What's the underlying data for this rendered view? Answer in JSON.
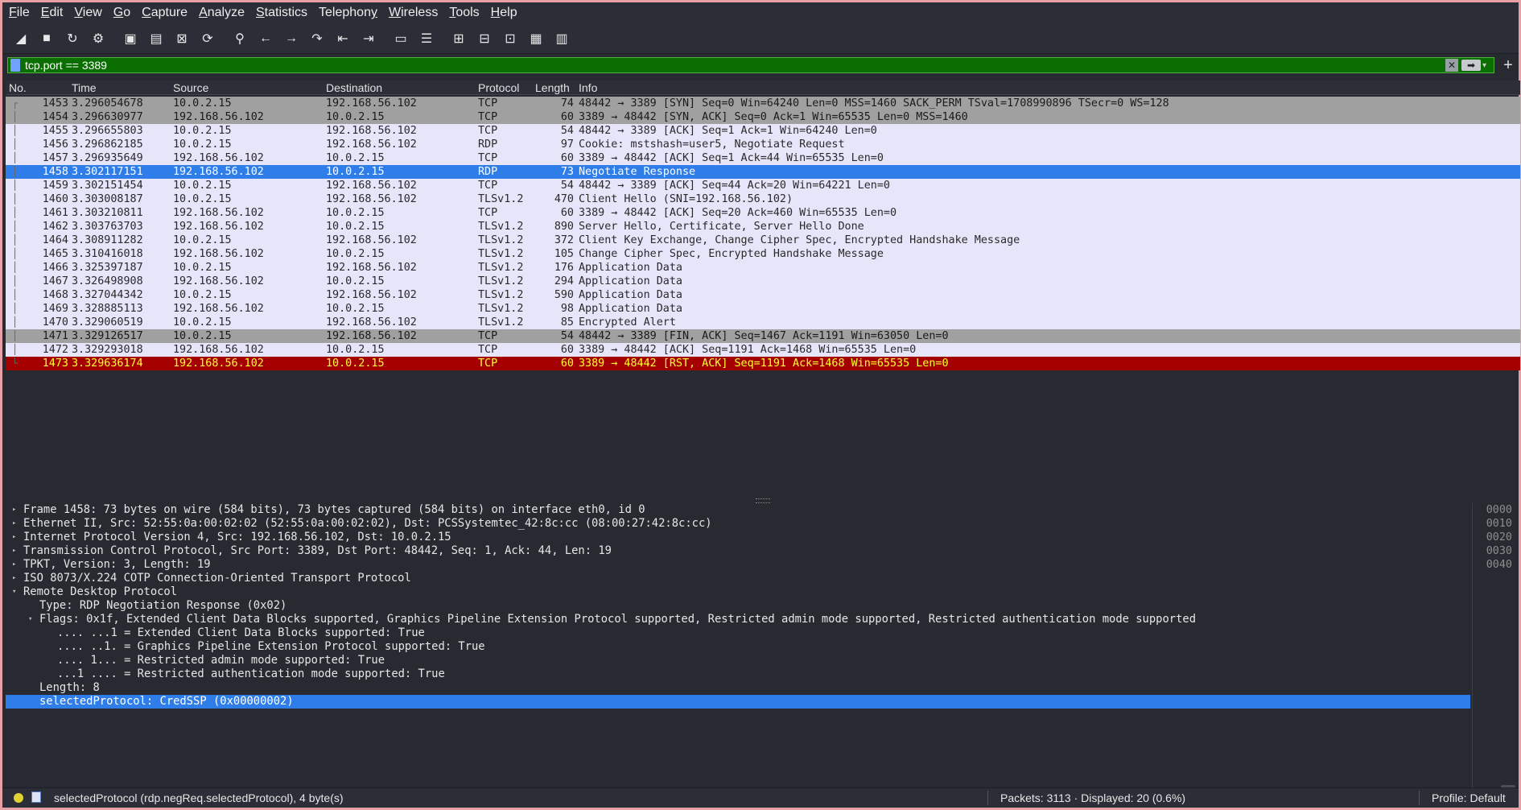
{
  "menu": [
    "File",
    "Edit",
    "View",
    "Go",
    "Capture",
    "Analyze",
    "Statistics",
    "Telephony",
    "Wireless",
    "Tools",
    "Help"
  ],
  "menu_mnemonics": [
    "F",
    "E",
    "V",
    "G",
    "C",
    "A",
    "S",
    "y",
    "W",
    "T",
    "H"
  ],
  "toolbar": [
    {
      "name": "shark-fin-start-icon",
      "glyph": "◢"
    },
    {
      "name": "stop-square-icon",
      "glyph": "■"
    },
    {
      "name": "restart-fin-icon",
      "glyph": "↻"
    },
    {
      "name": "capture-options-gear-icon",
      "glyph": "⚙"
    },
    {
      "name": "open-file-icon",
      "glyph": "▣"
    },
    {
      "name": "save-file-icon",
      "glyph": "▤"
    },
    {
      "name": "close-file-icon",
      "glyph": "⊠"
    },
    {
      "name": "reload-file-icon",
      "glyph": "⟳"
    },
    {
      "name": "find-packet-icon",
      "glyph": "⚲"
    },
    {
      "name": "go-back-icon",
      "glyph": "←"
    },
    {
      "name": "go-forward-icon",
      "glyph": "→"
    },
    {
      "name": "go-to-packet-icon",
      "glyph": "↷"
    },
    {
      "name": "go-first-icon",
      "glyph": "⇤"
    },
    {
      "name": "go-last-icon",
      "glyph": "⇥"
    },
    {
      "name": "autoscroll-icon",
      "glyph": "▭"
    },
    {
      "name": "colorize-icon",
      "glyph": "☰"
    },
    {
      "name": "zoom-in-icon",
      "glyph": "⊞"
    },
    {
      "name": "zoom-out-icon",
      "glyph": "⊟"
    },
    {
      "name": "normal-size-icon",
      "glyph": "⊡"
    },
    {
      "name": "resize-columns-icon",
      "glyph": "▦"
    },
    {
      "name": "layout-icon",
      "glyph": "▥"
    }
  ],
  "filter": {
    "value": "tcp.port == 3389",
    "clear": "✕",
    "apply": "➡",
    "dropdown": "▾",
    "add": "+"
  },
  "columns": {
    "no": "No.",
    "time": "Time",
    "source": "Source",
    "destination": "Destination",
    "protocol": "Protocol",
    "length": "Length",
    "info": "Info"
  },
  "packets": [
    {
      "no": "1453",
      "time": "3.296054678",
      "src": "10.0.2.15",
      "dst": "192.168.56.102",
      "proto": "TCP",
      "len": "74",
      "info": "48442 → 3389 [SYN] Seq=0 Win=64240 Len=0 MSS=1460 SACK_PERM TSval=1708990896 TSecr=0 WS=128",
      "style": "syn",
      "rel": "┌"
    },
    {
      "no": "1454",
      "time": "3.296630977",
      "src": "192.168.56.102",
      "dst": "10.0.2.15",
      "proto": "TCP",
      "len": "60",
      "info": "3389 → 48442 [SYN, ACK] Seq=0 Ack=1 Win=65535 Len=0 MSS=1460",
      "style": "syn",
      "rel": "│"
    },
    {
      "no": "1455",
      "time": "3.296655803",
      "src": "10.0.2.15",
      "dst": "192.168.56.102",
      "proto": "TCP",
      "len": "54",
      "info": "48442 → 3389 [ACK] Seq=1 Ack=1 Win=64240 Len=0",
      "style": "tcp",
      "rel": "│"
    },
    {
      "no": "1456",
      "time": "3.296862185",
      "src": "10.0.2.15",
      "dst": "192.168.56.102",
      "proto": "RDP",
      "len": "97",
      "info": "Cookie: mstshash=user5, Negotiate Request",
      "style": "tcp",
      "rel": "│"
    },
    {
      "no": "1457",
      "time": "3.296935649",
      "src": "192.168.56.102",
      "dst": "10.0.2.15",
      "proto": "TCP",
      "len": "60",
      "info": "3389 → 48442 [ACK] Seq=1 Ack=44 Win=65535 Len=0",
      "style": "tcp",
      "rel": "│"
    },
    {
      "no": "1458",
      "time": "3.302117151",
      "src": "192.168.56.102",
      "dst": "10.0.2.15",
      "proto": "RDP",
      "len": "73",
      "info": "Negotiate Response",
      "style": "sel",
      "rel": "│"
    },
    {
      "no": "1459",
      "time": "3.302151454",
      "src": "10.0.2.15",
      "dst": "192.168.56.102",
      "proto": "TCP",
      "len": "54",
      "info": "48442 → 3389 [ACK] Seq=44 Ack=20 Win=64221 Len=0",
      "style": "tcp",
      "rel": "│"
    },
    {
      "no": "1460",
      "time": "3.303008187",
      "src": "10.0.2.15",
      "dst": "192.168.56.102",
      "proto": "TLSv1.2",
      "len": "470",
      "info": "Client Hello (SNI=192.168.56.102)",
      "style": "tcp",
      "rel": "│"
    },
    {
      "no": "1461",
      "time": "3.303210811",
      "src": "192.168.56.102",
      "dst": "10.0.2.15",
      "proto": "TCP",
      "len": "60",
      "info": "3389 → 48442 [ACK] Seq=20 Ack=460 Win=65535 Len=0",
      "style": "tcp",
      "rel": "│"
    },
    {
      "no": "1462",
      "time": "3.303763703",
      "src": "192.168.56.102",
      "dst": "10.0.2.15",
      "proto": "TLSv1.2",
      "len": "890",
      "info": "Server Hello, Certificate, Server Hello Done",
      "style": "tcp",
      "rel": "│"
    },
    {
      "no": "1464",
      "time": "3.308911282",
      "src": "10.0.2.15",
      "dst": "192.168.56.102",
      "proto": "TLSv1.2",
      "len": "372",
      "info": "Client Key Exchange, Change Cipher Spec, Encrypted Handshake Message",
      "style": "tcp",
      "rel": "│"
    },
    {
      "no": "1465",
      "time": "3.310416018",
      "src": "192.168.56.102",
      "dst": "10.0.2.15",
      "proto": "TLSv1.2",
      "len": "105",
      "info": "Change Cipher Spec, Encrypted Handshake Message",
      "style": "tcp",
      "rel": "│"
    },
    {
      "no": "1466",
      "time": "3.325397187",
      "src": "10.0.2.15",
      "dst": "192.168.56.102",
      "proto": "TLSv1.2",
      "len": "176",
      "info": "Application Data",
      "style": "tcp",
      "rel": "│"
    },
    {
      "no": "1467",
      "time": "3.326498908",
      "src": "192.168.56.102",
      "dst": "10.0.2.15",
      "proto": "TLSv1.2",
      "len": "294",
      "info": "Application Data",
      "style": "tcp",
      "rel": "│"
    },
    {
      "no": "1468",
      "time": "3.327044342",
      "src": "10.0.2.15",
      "dst": "192.168.56.102",
      "proto": "TLSv1.2",
      "len": "590",
      "info": "Application Data",
      "style": "tcp",
      "rel": "│"
    },
    {
      "no": "1469",
      "time": "3.328885113",
      "src": "192.168.56.102",
      "dst": "10.0.2.15",
      "proto": "TLSv1.2",
      "len": "98",
      "info": "Application Data",
      "style": "tcp",
      "rel": "│"
    },
    {
      "no": "1470",
      "time": "3.329060519",
      "src": "10.0.2.15",
      "dst": "192.168.56.102",
      "proto": "TLSv1.2",
      "len": "85",
      "info": "Encrypted Alert",
      "style": "tcp",
      "rel": "│"
    },
    {
      "no": "1471",
      "time": "3.329126517",
      "src": "10.0.2.15",
      "dst": "192.168.56.102",
      "proto": "TCP",
      "len": "54",
      "info": "48442 → 3389 [FIN, ACK] Seq=1467 Ack=1191 Win=63050 Len=0",
      "style": "syn",
      "rel": "│"
    },
    {
      "no": "1472",
      "time": "3.329293018",
      "src": "192.168.56.102",
      "dst": "10.0.2.15",
      "proto": "TCP",
      "len": "60",
      "info": "3389 → 48442 [ACK] Seq=1191 Ack=1468 Win=65535 Len=0",
      "style": "tcp",
      "rel": "│"
    },
    {
      "no": "1473",
      "time": "3.329636174",
      "src": "192.168.56.102",
      "dst": "10.0.2.15",
      "proto": "TCP",
      "len": "60",
      "info": "3389 → 48442 [RST, ACK] Seq=1191 Ack=1468 Win=65535 Len=0",
      "style": "rst",
      "rel": "└"
    }
  ],
  "details": [
    {
      "text": "Frame 1458: 73 bytes on wire (584 bits), 73 bytes captured (584 bits) on interface eth0, id 0",
      "indent": 0,
      "arrow": "▸"
    },
    {
      "text": "Ethernet II, Src: 52:55:0a:00:02:02 (52:55:0a:00:02:02), Dst: PCSSystemtec_42:8c:cc (08:00:27:42:8c:cc)",
      "indent": 0,
      "arrow": "▸"
    },
    {
      "text": "Internet Protocol Version 4, Src: 192.168.56.102, Dst: 10.0.2.15",
      "indent": 0,
      "arrow": "▸"
    },
    {
      "text": "Transmission Control Protocol, Src Port: 3389, Dst Port: 48442, Seq: 1, Ack: 44, Len: 19",
      "indent": 0,
      "arrow": "▸"
    },
    {
      "text": "TPKT, Version: 3, Length: 19",
      "indent": 0,
      "arrow": "▸"
    },
    {
      "text": "ISO 8073/X.224 COTP Connection-Oriented Transport Protocol",
      "indent": 0,
      "arrow": "▸"
    },
    {
      "text": "Remote Desktop Protocol",
      "indent": 0,
      "arrow": "▾"
    },
    {
      "text": "Type: RDP Negotiation Response (0x02)",
      "indent": 1,
      "arrow": ""
    },
    {
      "text": "Flags: 0x1f, Extended Client Data Blocks supported, Graphics Pipeline Extension Protocol supported, Restricted admin mode supported, Restricted authentication mode supported",
      "indent": 1,
      "arrow": "▾"
    },
    {
      "text": ".... ...1 = Extended Client Data Blocks supported: True",
      "indent": 2,
      "arrow": ""
    },
    {
      "text": ".... ..1. = Graphics Pipeline Extension Protocol supported: True",
      "indent": 2,
      "arrow": ""
    },
    {
      "text": ".... 1... = Restricted admin mode supported: True",
      "indent": 2,
      "arrow": ""
    },
    {
      "text": "...1 .... = Restricted authentication mode supported: True",
      "indent": 2,
      "arrow": ""
    },
    {
      "text": "Length: 8",
      "indent": 1,
      "arrow": ""
    },
    {
      "text": "selectedProtocol: CredSSP (0x00000002)",
      "indent": 1,
      "arrow": "",
      "selected": true
    }
  ],
  "bytes_offsets": [
    "0000",
    "0010",
    "0020",
    "0030",
    "0040"
  ],
  "status": {
    "field": "selectedProtocol (rdp.negReq.selectedProtocol), 4 byte(s)",
    "packets": "Packets: 3113 · Displayed: 20 (0.6%)",
    "profile": "Profile: Default"
  }
}
